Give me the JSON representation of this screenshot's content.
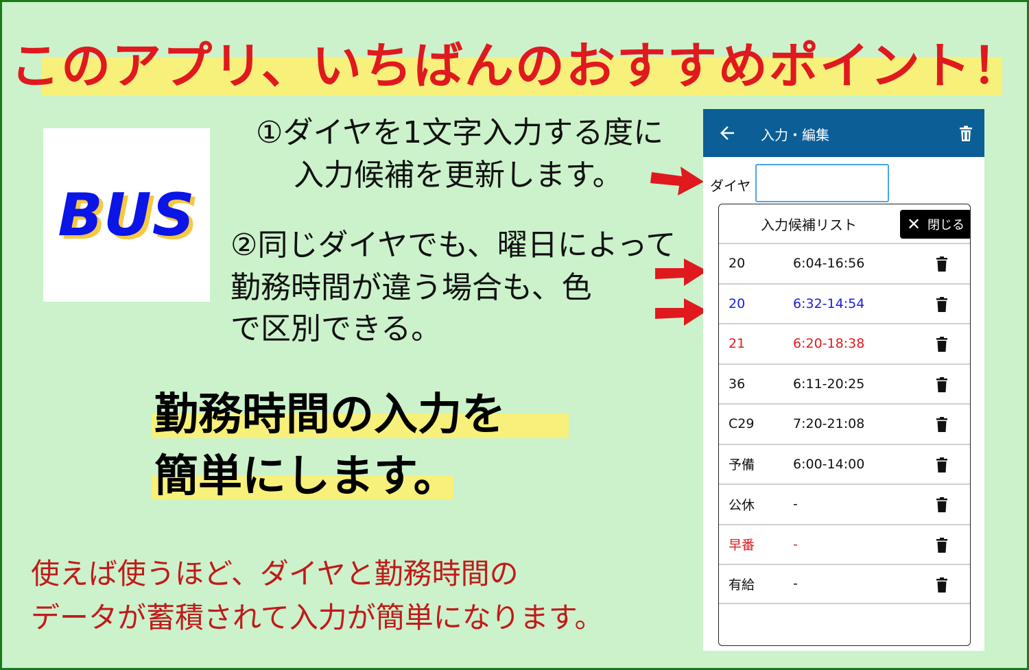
{
  "headline": "このアプリ、いちばんのおすすめポイント！",
  "logo_text": "BUS",
  "note1": [
    "①ダイヤを1文字入力する度に",
    "入力候補を更新します。"
  ],
  "note2": [
    "②同じダイヤでも、曜日によって",
    "勤務時間が違う場合も、色",
    "で区別できる。"
  ],
  "big": [
    "勤務時間の入力を",
    "簡単にします。"
  ],
  "footer": [
    "使えば使うほど、ダイヤと勤務時間の",
    "データが蓄積されて入力が簡単になります。"
  ],
  "app": {
    "title": "入力・編集",
    "dia_label": "ダイヤ",
    "dia_value": "",
    "list_title": "入力候補リスト",
    "close_label": "閉じる",
    "rows": [
      {
        "code": "20",
        "time": "6:04-16:56",
        "color": "#111111"
      },
      {
        "code": "20",
        "time": "6:32-14:54",
        "color": "#1a1ae6"
      },
      {
        "code": "21",
        "time": "6:20-18:38",
        "color": "#e0191f"
      },
      {
        "code": "36",
        "time": "6:11-20:25",
        "color": "#111111"
      },
      {
        "code": "C29",
        "time": "7:20-21:08",
        "color": "#111111"
      },
      {
        "code": "予備",
        "time": "6:00-14:00",
        "color": "#111111"
      },
      {
        "code": "公休",
        "time": "-",
        "color": "#111111"
      },
      {
        "code": "早番",
        "time": "-",
        "color": "#e0191f"
      },
      {
        "code": "有給",
        "time": "-",
        "color": "#111111"
      }
    ]
  },
  "colors": {
    "accent_red": "#e0191f",
    "app_bar": "#0b5f96",
    "background": "#cbf2cb",
    "highlight": "#f7f07a"
  }
}
